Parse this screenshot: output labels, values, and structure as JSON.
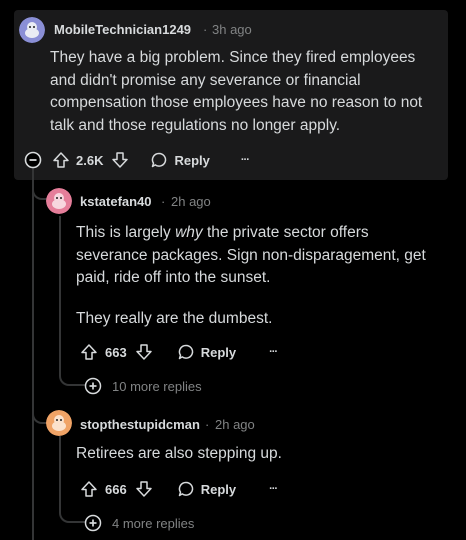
{
  "comments": [
    {
      "username": "MobileTechnician1249",
      "separator": "·",
      "time": "3h ago",
      "body": [
        "They have a big problem. Since they fired employees and didn't promise any severance or financial compensation those employees have no reason to not talk and those regulations no longer apply."
      ],
      "votes": "2.6K",
      "reply_label": "Reply",
      "more_label": "···",
      "avatar_color": "#8a8fd6"
    },
    {
      "username": "kstatefan40",
      "separator": "·",
      "time": "2h ago",
      "body_pre": "This is largely ",
      "body_em": "why",
      "body_post": " the private sector offers severance packages. Sign non-disparagement, get paid, ride off into the sunset.",
      "body_p2": "They really are the dumbest.",
      "votes": "663",
      "reply_label": "Reply",
      "more_label": "···",
      "more_replies": "10 more replies",
      "avatar_color": "#e57e9a"
    },
    {
      "username": "stopthestupidcman",
      "separator": "·",
      "time": "2h ago",
      "body": [
        "Retirees are also stepping up."
      ],
      "votes": "666",
      "reply_label": "Reply",
      "more_label": "···",
      "more_replies": "4 more replies",
      "avatar_color": "#f0a366"
    }
  ]
}
